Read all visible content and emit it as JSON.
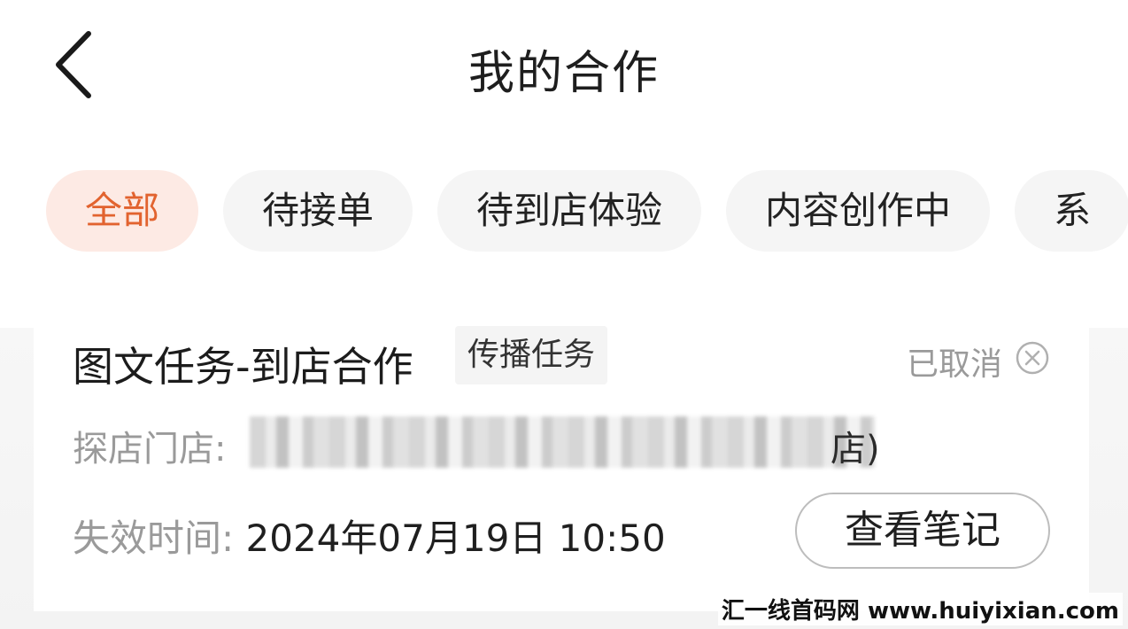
{
  "header": {
    "title": "我的合作",
    "back_icon": "chevron-left-icon"
  },
  "tabs": [
    {
      "label": "全部",
      "active": true
    },
    {
      "label": "待接单",
      "active": false
    },
    {
      "label": "待到店体验",
      "active": false
    },
    {
      "label": "内容创作中",
      "active": false
    },
    {
      "label": "系",
      "active": false
    }
  ],
  "card": {
    "title": "图文任务-到店合作",
    "tag": "传播任务",
    "status": "已取消",
    "status_icon": "circle-x-icon",
    "store_label": "探店门店:",
    "store_name_visible_suffix": "店)",
    "expire_label": "失效时间:",
    "expire_value": "2024年07月19日 10:50",
    "view_note_button": "查看笔记"
  },
  "watermark": "汇一线首码网 www.huiyixian.com",
  "colors": {
    "accent": "#e2632f",
    "accent_bg": "#fdeae4",
    "muted_text": "#9a9a9a"
  }
}
